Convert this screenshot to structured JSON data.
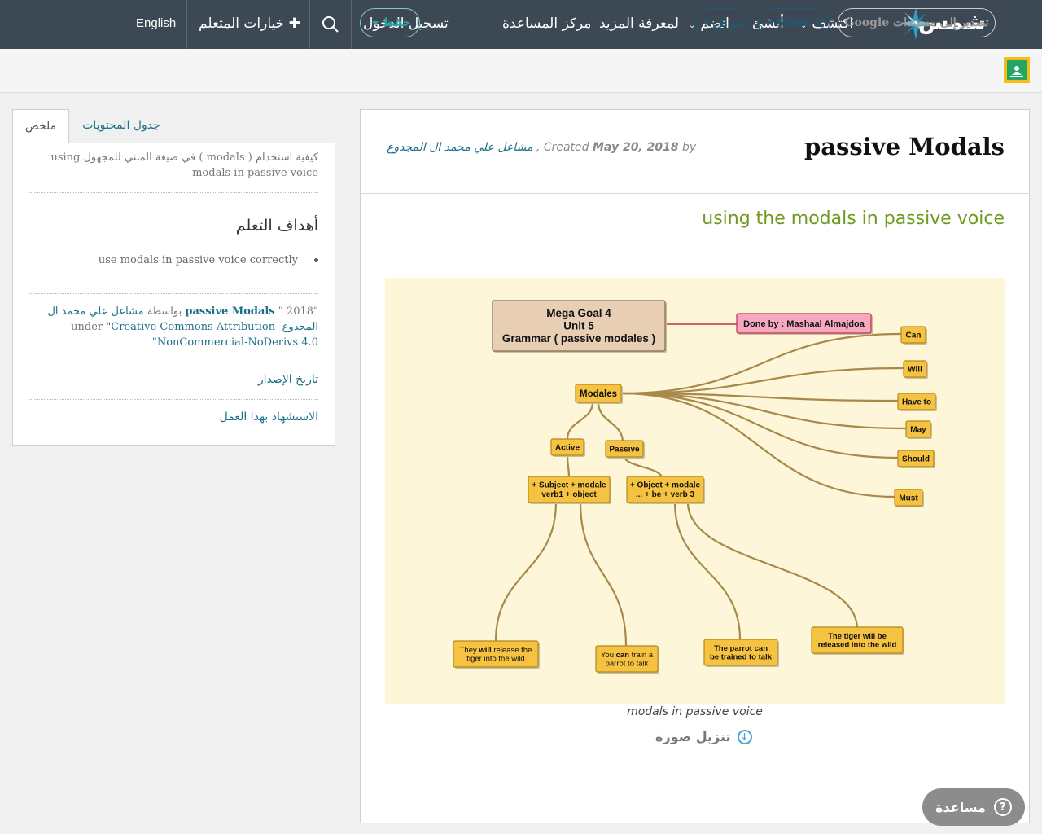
{
  "nav": {
    "logo_text": "شمس",
    "explore": "اكتشف",
    "create": "أنشئ",
    "join": "انضم",
    "learn_more": "لمعرفة المزيد",
    "help_center": "مركز المساعدة",
    "login": "تسجيل الدخول",
    "learner_options": "خيارات المتعلم",
    "language": "English"
  },
  "toolbar": {
    "export_google": "تصدير إلى مستندات Google",
    "share": "Share",
    "download": "تنزيل",
    "save": "حفظ"
  },
  "document": {
    "title": "passive Modals",
    "meta_by": "by",
    "meta_created": ", Created",
    "meta_date": "May 20, 2018",
    "meta_author": "مشاعل علي محمد ال المجدوع",
    "section_title": "using the modals in passive voice",
    "figure_caption": "modals in passive voice",
    "image_download": "تنزيل صورة"
  },
  "mindmap": {
    "root": [
      "Mega Goal 4",
      "Unit 5",
      "Grammar ( passive modales )"
    ],
    "done_by": "Done by : Mashaal Almajdoa",
    "hub": "Modales",
    "modals": [
      "Can",
      "Will",
      "Have to",
      "May",
      "Should",
      "Must"
    ],
    "active": "Active",
    "passive": "Passive",
    "active_rule": [
      "Subject + modale +",
      "verb1 + object"
    ],
    "passive_rule": [
      "Object + modale +",
      "be + verb 3 + ..."
    ],
    "examples": [
      {
        "pre": "They ",
        "bold": "will",
        "post": " release the",
        "line2": "tiger into the wild"
      },
      {
        "pre": "You ",
        "bold": "can",
        "post": " train a",
        "line2": "parrot to talk"
      },
      {
        "pre": "The parrot ",
        "bold": "can",
        "post": "",
        "line2": "be trained to talk"
      },
      {
        "pre": "The tiger ",
        "bold": "will",
        "post": " be",
        "line2": "released into the wild"
      }
    ],
    "colors": {
      "node_fill": "#f5c242",
      "node_stroke": "#b38a1e",
      "root_fill": "#e8cfb4",
      "done_fill": "#f6a8c0",
      "done_stroke": "#c0304f",
      "bg": "#fdf6d8",
      "branch": "#a8894a"
    }
  },
  "sidebar": {
    "tab_summary": "ملخص",
    "tab_toc": "جدول المحتويات",
    "description": "كيفية استخدام ( modals ) في صيغة المبني للمجهول using modals in passive voice",
    "objectives_heading": "أهداف التعلم",
    "objective_1": "use modals in passive voice correctly",
    "license_year": "\"2018 \"",
    "license_title": "passive Modals",
    "license_by": "بواسطة",
    "license_author": "مشاعل علي محمد ال المجدوع",
    "license_under": "under",
    "license_name": "\"Creative Commons Attribution-NonCommercial-NoDerivs 4.0\"",
    "version_date": "تاريخ الإصدار",
    "cite": "الاستشهاد بهذا العمل"
  },
  "help": {
    "label": "مساعدة"
  },
  "colors": {
    "nav_bg": "#3d4855",
    "accent_teal": "#1e6f8a",
    "section_green": "#6f9a1e"
  }
}
